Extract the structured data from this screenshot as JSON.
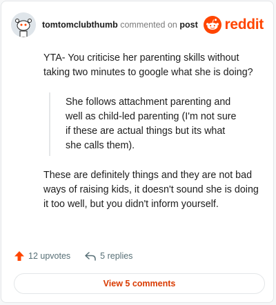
{
  "comment": {
    "username": "tomtomclubthumb",
    "action_text": "commented on",
    "post_link": "post",
    "paragraph1": "YTA- You criticise her parenting skills without taking two minutes to google what she is doing?",
    "quote": "She follows attachment parenting and well as child-led parenting (I'm not sure if these are actual things but its what she calls them).",
    "paragraph2": "These are definitely things and they are not bad ways of raising kids, it doesn't sound she is doing it too well, but you didn't inform yourself."
  },
  "brand": {
    "name": "reddit",
    "color": "#ff4500"
  },
  "stats": {
    "upvotes": "12 upvotes",
    "replies": "5 replies"
  },
  "buttons": {
    "view_comments": "View 5 comments"
  }
}
